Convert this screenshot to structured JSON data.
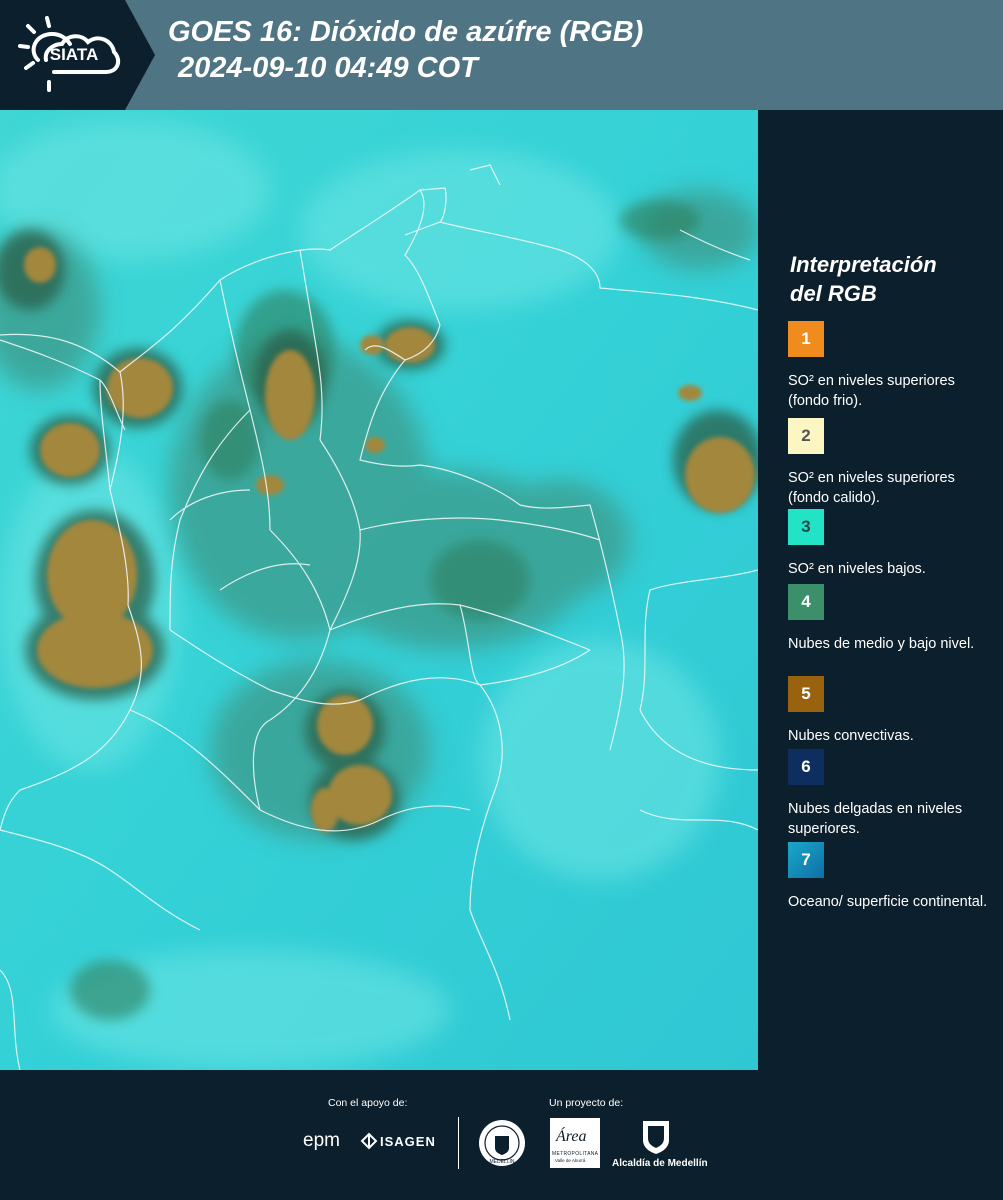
{
  "header": {
    "logo_text": "SIATA",
    "title_line1": "GOES 16: Dióxido de azúfre (RGB)",
    "title_line2": "2024-09-10 04:49 COT"
  },
  "legend": {
    "title_line1": "Interpretación",
    "title_line2": "del RGB",
    "items": [
      {
        "num": "1",
        "color": "#f08c1e",
        "text": "SO² en niveles superiores (fondo frio)."
      },
      {
        "num": "2",
        "color": "#fbf6c2",
        "text": "SO² en niveles superiores (fondo calido)."
      },
      {
        "num": "3",
        "color": "#23e3c6",
        "text": "SO² en niveles bajos."
      },
      {
        "num": "4",
        "color": "#3b8f6b",
        "text": "Nubes de medio y bajo nivel."
      },
      {
        "num": "5",
        "color": "#99620f",
        "text": "Nubes convectivas."
      },
      {
        "num": "6",
        "color": "#0d2e5e",
        "text": "Nubes delgadas en niveles superiores."
      },
      {
        "num": "7",
        "color": "#1c9cc4",
        "text": "Oceano/ superficie continental."
      }
    ]
  },
  "footer": {
    "support_label": "Con el apoyo de:",
    "project_label": "Un proyecto de:",
    "epm": "epm",
    "isagen": "ISAGEN",
    "area_name": "Área",
    "area_sub": "METROPOLITANA",
    "area_sub2": "Valle de Aburrá",
    "alcaldia": "Alcaldía de Medellín",
    "seal_text": "MEDELLÍN"
  }
}
